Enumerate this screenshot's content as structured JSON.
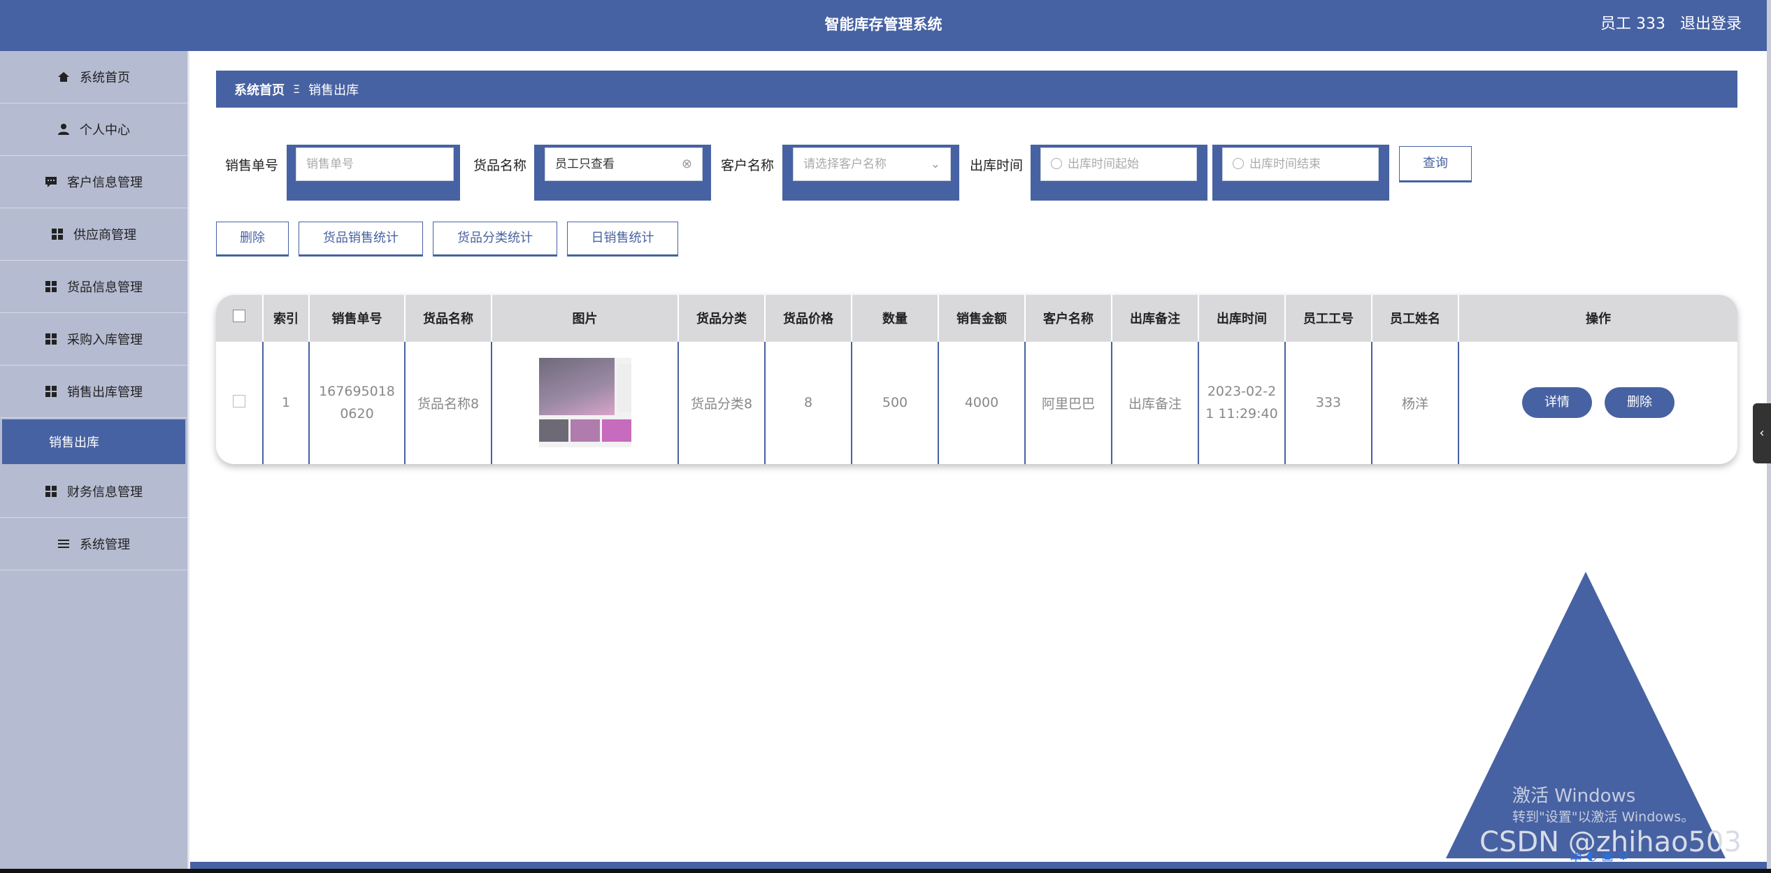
{
  "header": {
    "title": "智能库存管理系统",
    "user": "员工 333",
    "logout": "退出登录"
  },
  "sidebar": {
    "items": [
      {
        "label": "系统首页",
        "icon": "home-icon"
      },
      {
        "label": "个人中心",
        "icon": "user-icon"
      },
      {
        "label": "客户信息管理",
        "icon": "message-icon"
      },
      {
        "label": "供应商管理",
        "icon": "grid-icon"
      },
      {
        "label": "货品信息管理",
        "icon": "grid-icon"
      },
      {
        "label": "采购入库管理",
        "icon": "grid-icon"
      },
      {
        "label": "销售出库管理",
        "icon": "grid-icon"
      },
      {
        "label": "销售出库",
        "icon": "",
        "active": true
      },
      {
        "label": "财务信息管理",
        "icon": "grid-icon"
      },
      {
        "label": "系统管理",
        "icon": "menu-icon"
      }
    ]
  },
  "breadcrumb": {
    "home": "系统首页",
    "separator": "Ξ",
    "current": "销售出库"
  },
  "filters": {
    "order_no": {
      "label": "销售单号",
      "placeholder": "销售单号"
    },
    "goods_name": {
      "label": "货品名称",
      "value": "员工只查看"
    },
    "customer": {
      "label": "客户名称",
      "placeholder": "请选择客户名称"
    },
    "time": {
      "label": "出库时间",
      "start_placeholder": "出库时间起始",
      "end_placeholder": "出库时间结束"
    },
    "query_button": "查询"
  },
  "actions": {
    "delete": "删除",
    "goods_stats": "货品销售统计",
    "category_stats": "货品分类统计",
    "daily_stats": "日销售统计"
  },
  "table": {
    "columns": [
      "索引",
      "销售单号",
      "货品名称",
      "图片",
      "货品分类",
      "货品价格",
      "数量",
      "销售金额",
      "客户名称",
      "出库备注",
      "出库时间",
      "员工工号",
      "员工姓名",
      "操作"
    ],
    "rows": [
      {
        "index": "1",
        "order_no": "1676950180620",
        "goods_name": "货品名称8",
        "category": "货品分类8",
        "price": "8",
        "quantity": "500",
        "amount": "4000",
        "customer": "阿里巴巴",
        "remark": "出库备注",
        "time": "2023-02-21 11:29:40",
        "emp_no": "333",
        "emp_name": "杨洋",
        "detail_button": "详情",
        "delete_button": "删除"
      }
    ]
  },
  "overlay": {
    "win_line1": "激活 Windows",
    "win_line2": "转到\"设置\"以激活 Windows。",
    "csdn": "CSDN @zhihao503"
  },
  "colors": {
    "primary": "#4762a2",
    "sidebar": "#b5bbd1"
  }
}
